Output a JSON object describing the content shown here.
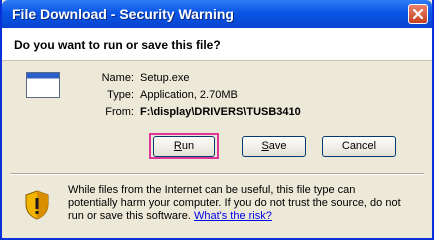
{
  "window": {
    "title": "File Download - Security Warning"
  },
  "dialog": {
    "question": "Do you want to run or save this file?",
    "name_label": "Name:",
    "name_value": "Setup.exe",
    "type_label": "Type:",
    "type_value": "Application, 2.70MB",
    "from_label": "From:",
    "from_value": "F:\\display\\DRIVERS\\TUSB3410"
  },
  "buttons": {
    "run_accel": "R",
    "run_rest": "un",
    "save_accel": "S",
    "save_rest": "ave",
    "cancel": "Cancel"
  },
  "warning": {
    "line1": "While files from the Internet can be useful, this file type can",
    "line2": "potentially harm your computer. If you do not trust the source, do not",
    "line3": "run or save this software.",
    "link": "What's the risk?"
  },
  "colors": {
    "title_bar": "#0a55e6",
    "highlight": "#e0359a",
    "link": "#0000ee"
  },
  "icons": [
    "close-icon",
    "file-icon",
    "shield-warning-icon"
  ]
}
